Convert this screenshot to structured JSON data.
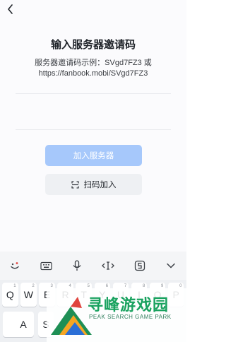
{
  "title": "输入服务器邀请码",
  "hint": {
    "line1": "服务器邀请码示例：SVgd7FZ3 或",
    "line2": "https://fanbook.mobi/SVgd7FZ3"
  },
  "invite_input": {
    "value": "",
    "placeholder": ""
  },
  "buttons": {
    "join": "加入服务器",
    "scan": "扫码加入"
  },
  "keyboard": {
    "row1": [
      {
        "k": "Q",
        "h": "1"
      },
      {
        "k": "W",
        "h": "2"
      },
      {
        "k": "E",
        "h": "3"
      },
      {
        "k": "R",
        "h": "4"
      },
      {
        "k": "T",
        "h": "5"
      },
      {
        "k": "Y",
        "h": "6"
      },
      {
        "k": "U",
        "h": "7"
      },
      {
        "k": "I",
        "h": "8"
      },
      {
        "k": "O",
        "h": "9"
      },
      {
        "k": "P",
        "h": "0"
      }
    ],
    "row2_left": "A",
    "row2_right": "S"
  },
  "watermark": {
    "text": "寻峰游戏园",
    "subtitle": "PEAK SEARCH GAME PARK"
  },
  "colors": {
    "primary_disabled": "#a6c8fb",
    "watermark_green": "#19a25f"
  }
}
